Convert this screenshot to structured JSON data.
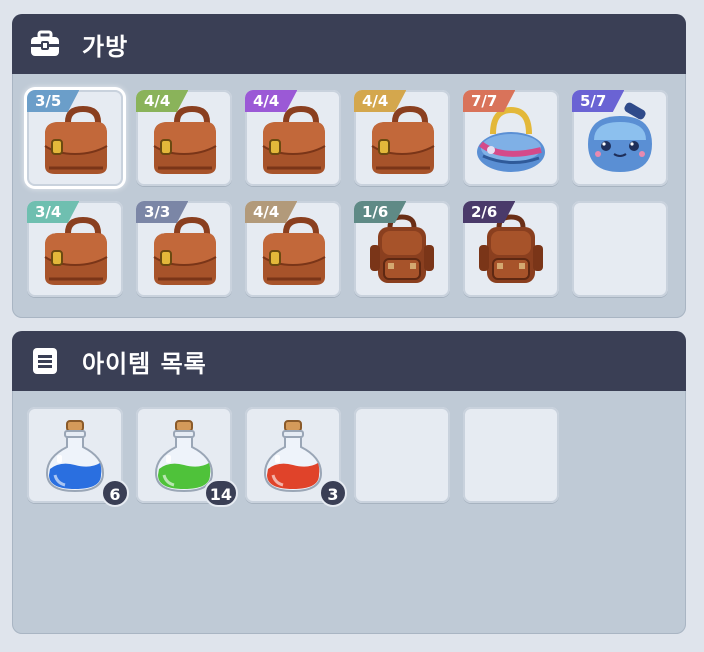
{
  "bag_panel": {
    "title": "가방",
    "icon": "toolbox-icon",
    "slots": [
      {
        "capacity": "3/5",
        "tag_color": "#6b9ec9",
        "item": "brown-satchel-icon",
        "selected": true
      },
      {
        "capacity": "4/4",
        "tag_color": "#8ab35a",
        "item": "brown-satchel-icon"
      },
      {
        "capacity": "4/4",
        "tag_color": "#9b59d6",
        "item": "brown-satchel-icon"
      },
      {
        "capacity": "4/4",
        "tag_color": "#d4a74d",
        "item": "brown-satchel-icon"
      },
      {
        "capacity": "7/7",
        "tag_color": "#d9735a",
        "item": "blue-duffel-bag-icon"
      },
      {
        "capacity": "5/7",
        "tag_color": "#6a63d4",
        "item": "blue-slime-bag-icon"
      },
      {
        "capacity": "3/4",
        "tag_color": "#6fbfb0",
        "item": "brown-satchel-icon"
      },
      {
        "capacity": "3/3",
        "tag_color": "#7b86a6",
        "item": "brown-satchel-icon"
      },
      {
        "capacity": "4/4",
        "tag_color": "#b29a7a",
        "item": "brown-satchel-icon"
      },
      {
        "capacity": "1/6",
        "tag_color": "#5f8a86",
        "item": "brown-backpack-icon"
      },
      {
        "capacity": "2/6",
        "tag_color": "#4a3a6a",
        "item": "brown-backpack-icon"
      },
      {
        "capacity": "",
        "tag_color": "",
        "item": "empty"
      }
    ]
  },
  "item_panel": {
    "title": "아이템 목록",
    "icon": "list-icon",
    "slots": [
      {
        "item": "blue-potion-icon",
        "count": "6",
        "liquid": "#2a6fe0"
      },
      {
        "item": "green-potion-icon",
        "count": "14",
        "liquid": "#4fc23a"
      },
      {
        "item": "red-potion-icon",
        "count": "3",
        "liquid": "#e0432a"
      },
      {
        "item": "empty",
        "count": ""
      },
      {
        "item": "empty",
        "count": ""
      }
    ]
  }
}
